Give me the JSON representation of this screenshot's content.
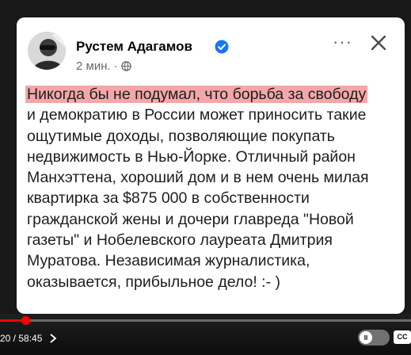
{
  "post": {
    "author": "Рустем Адагамов",
    "time": "2 мин.",
    "separator": "·",
    "more_label": "···",
    "lines": [
      "Никогда бы не подумал, что борьба за свободу",
      "и демократию в России может приносить такие",
      "ощутимые доходы, позволяющие покупать",
      "недвижимость в Нью-Йорке. Отличный район",
      "Манхэттена, хороший дом и в нем очень милая",
      "квартирка за $875 000 в собственности",
      "гражданской жены и дочери главреда \"Новой",
      "газеты\" и Нобелевского лауреата Дмитрия",
      "Муратова. Независимая журналистика,",
      "оказывается, прибыльное дело! :- )"
    ]
  },
  "player": {
    "time_display": "20 / 58:45",
    "progress": 0.061,
    "toggle_label": "II",
    "cc_label": "CC"
  },
  "colors": {
    "highlight": "#f4a7a9",
    "verified": "#1877f2",
    "progress": "#ff0000"
  },
  "icons": {
    "verified": "verified-badge-icon",
    "globe": "globe-icon",
    "close": "close-icon",
    "more": "more-options-icon",
    "chevron": "chevron-right-icon"
  }
}
